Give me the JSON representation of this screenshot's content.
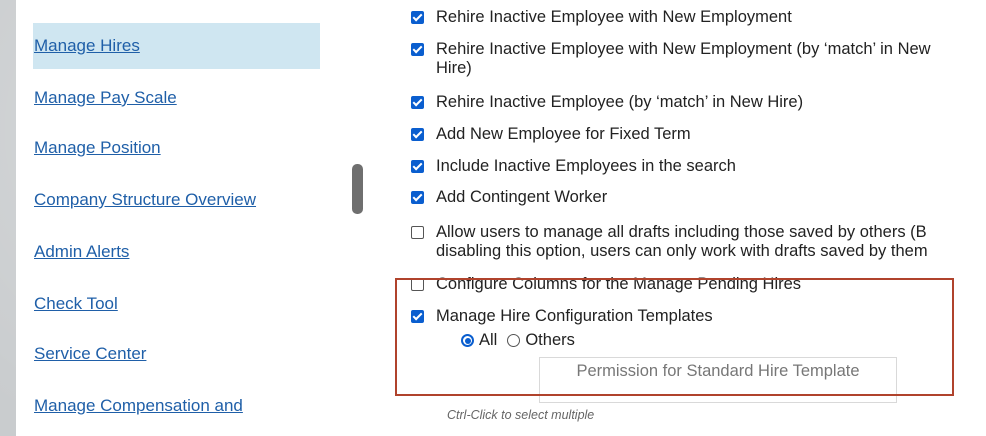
{
  "nav": {
    "items": [
      {
        "label": "Manage Hires",
        "active": true
      },
      {
        "label": "Manage Pay Scale",
        "active": false
      },
      {
        "label": "Manage Position",
        "active": false
      },
      {
        "label": "Company Structure Overview",
        "active": false
      },
      {
        "label": "Admin Alerts",
        "active": false
      },
      {
        "label": "Check Tool",
        "active": false
      },
      {
        "label": "Service Center",
        "active": false
      },
      {
        "label": "Manage Compensation and",
        "active": false
      }
    ]
  },
  "options": [
    {
      "label": "Rehire Inactive Employee with New Employment",
      "checked": true
    },
    {
      "label": "Rehire Inactive Employee with New Employment (by ‘match’ in New\nHire)",
      "checked": true
    },
    {
      "label": "Rehire Inactive Employee (by ‘match’ in New Hire)",
      "checked": true
    },
    {
      "label": "Add New Employee for Fixed Term",
      "checked": true
    },
    {
      "label": "Include Inactive Employees in the search",
      "checked": true
    },
    {
      "label": "Add Contingent Worker",
      "checked": true
    },
    {
      "label": "Allow users to manage all drafts including those saved by others (B\ndisabling this option, users can only work with drafts saved by them",
      "checked": false
    },
    {
      "label": "Configure Columns for the Manage Pending Hires",
      "checked": false
    },
    {
      "label": "Manage Hire Configuration Templates",
      "checked": true
    }
  ],
  "scope": {
    "all_label": "All",
    "others_label": "Others",
    "selected": "All"
  },
  "template_select": {
    "placeholder": "Permission for Standard Hire Template"
  },
  "hint": "Ctrl-Click to select multiple",
  "colors": {
    "link": "#1f5fa8",
    "active_nav_bg": "#cfe6f1",
    "checkbox": "#0a5ecf",
    "highlight_border": "#b0432c"
  }
}
